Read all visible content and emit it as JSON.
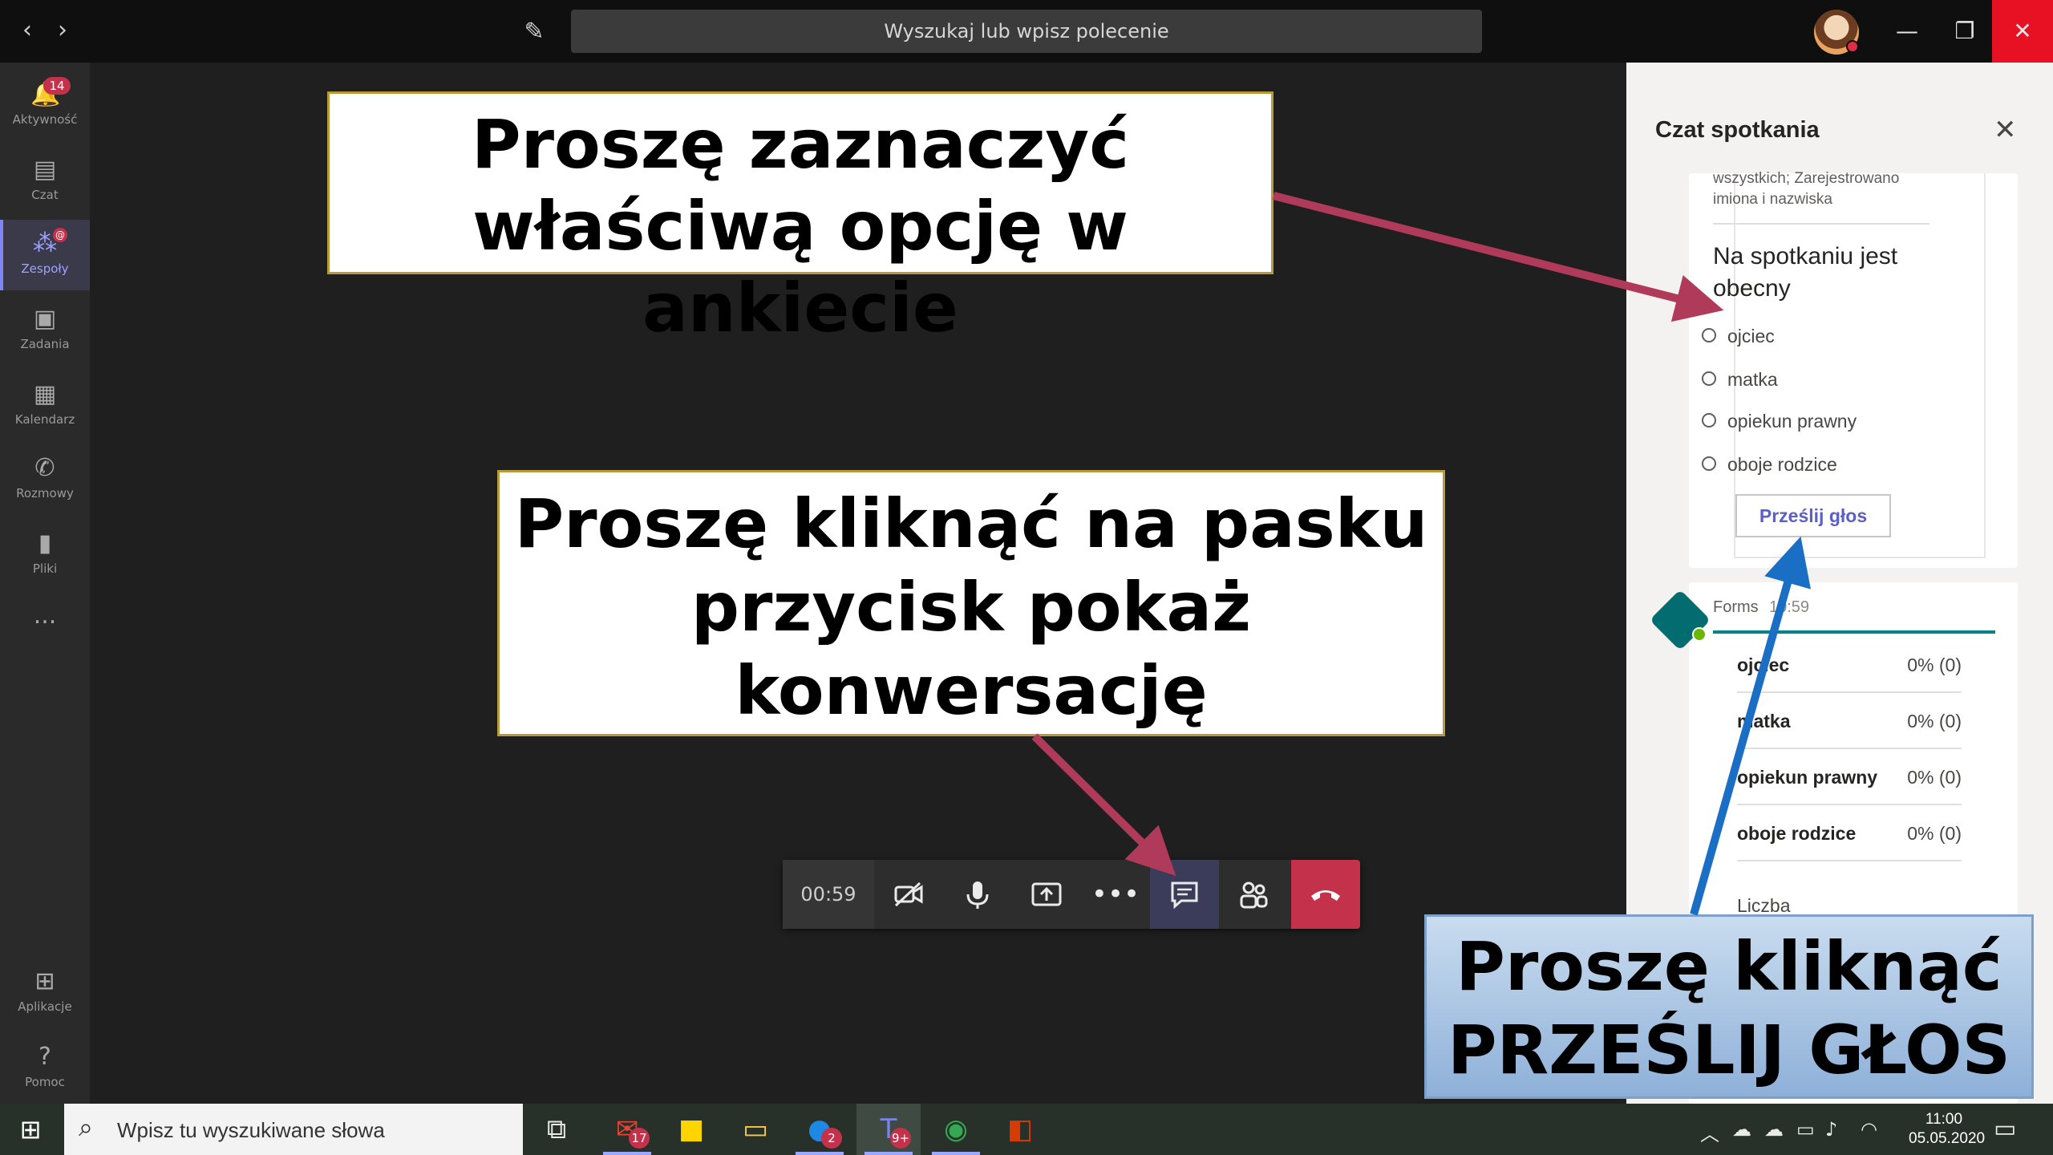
{
  "titlebar": {
    "search_text": "Wyszukaj lub wpisz polecenie",
    "back_icon": "chevron-left-icon",
    "forward_icon": "chevron-right-icon",
    "compose_icon": "compose-icon"
  },
  "rail": {
    "items": [
      {
        "label": "Aktywność",
        "icon": "bell-icon",
        "badge": "14"
      },
      {
        "label": "Czat",
        "icon": "chat-icon"
      },
      {
        "label": "Zespoły",
        "icon": "teams-icon"
      },
      {
        "label": "Zadania",
        "icon": "assignments-icon"
      },
      {
        "label": "Kalendarz",
        "icon": "calendar-icon"
      },
      {
        "label": "Rozmowy",
        "icon": "phone-icon"
      },
      {
        "label": "Pliki",
        "icon": "files-icon"
      },
      {
        "label": "...",
        "icon": "more-icon"
      }
    ],
    "bottom": [
      {
        "label": "Aplikacje",
        "icon": "apps-icon"
      },
      {
        "label": "Pomoc",
        "icon": "help-icon"
      }
    ]
  },
  "toolbar": {
    "timer": "00:59"
  },
  "chat": {
    "title": "Czat spotkania",
    "poll": {
      "meta": "wszystkich; Zarejestrowano imiona i nazwiska",
      "question": "Na spotkaniu jest obecny",
      "options": [
        "ojciec",
        "matka",
        "opiekun prawny",
        "oboje rodzice"
      ],
      "submit": "Prześlij głos"
    },
    "results": {
      "sender": "Forms",
      "time": "10:59",
      "rows": [
        {
          "label": "ojciec",
          "value": "0% (0)"
        },
        {
          "label": "matka",
          "value": "0% (0)"
        },
        {
          "label": "opiekun prawny",
          "value": "0% (0)"
        },
        {
          "label": "oboje rodzice",
          "value": "0% (0)"
        }
      ],
      "footer": "Liczba"
    }
  },
  "callouts": {
    "one": "Proszę zaznaczyć właściwą opcję w ankiecie",
    "two": "Proszę kliknąć na pasku przycisk pokaż konwersację",
    "three": "Proszę kliknąć PRZEŚLIJ GŁOS"
  },
  "taskbar": {
    "search_placeholder": "Wpisz tu wyszukiwane słowa",
    "apps": [
      {
        "icon": "task-view-icon"
      },
      {
        "icon": "gmail-icon",
        "badge": "17"
      },
      {
        "icon": "sticky-notes-icon"
      },
      {
        "icon": "file-explorer-icon"
      },
      {
        "icon": "messenger-icon",
        "badge": "2"
      },
      {
        "icon": "teams-icon",
        "badge": "9+"
      },
      {
        "icon": "chrome-icon"
      },
      {
        "icon": "office-icon"
      }
    ],
    "time": "11:00",
    "date": "05.05.2020"
  },
  "colors": {
    "accent": "#7f85f5",
    "end_call": "#c4314b",
    "annotation_arrow_red": "#b03a5a",
    "annotation_arrow_blue": "#1a6fc4"
  }
}
